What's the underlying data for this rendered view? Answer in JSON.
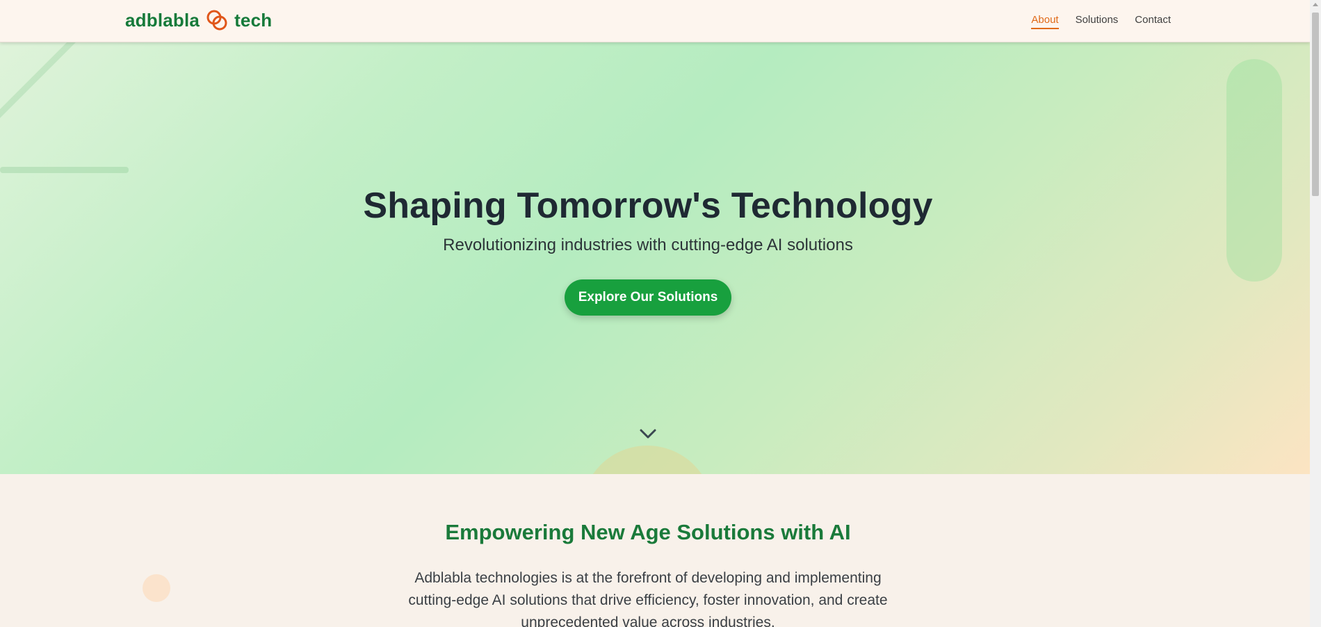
{
  "header": {
    "logo_left": "adblabla",
    "logo_right": "tech",
    "logo_icon": "interlocked-rings-icon",
    "nav": [
      {
        "label": "About",
        "active": true
      },
      {
        "label": "Solutions",
        "active": false
      },
      {
        "label": "Contact",
        "active": false
      }
    ]
  },
  "hero": {
    "title": "Shaping Tomorrow's Technology",
    "subtitle": "Revolutionizing industries with cutting-edge AI solutions",
    "cta_label": "Explore Our Solutions",
    "scroll_icon": "chevron-down-icon"
  },
  "about": {
    "title": "Empowering New Age Solutions with AI",
    "body": "Adblabla technologies is at the forefront of developing and implementing cutting-edge AI solutions that drive efficiency, foster innovation, and create unprecedented value across industries."
  },
  "colors": {
    "brand_green": "#167a3a",
    "accent_orange": "#e06a18",
    "cta_green": "#18a03e"
  }
}
